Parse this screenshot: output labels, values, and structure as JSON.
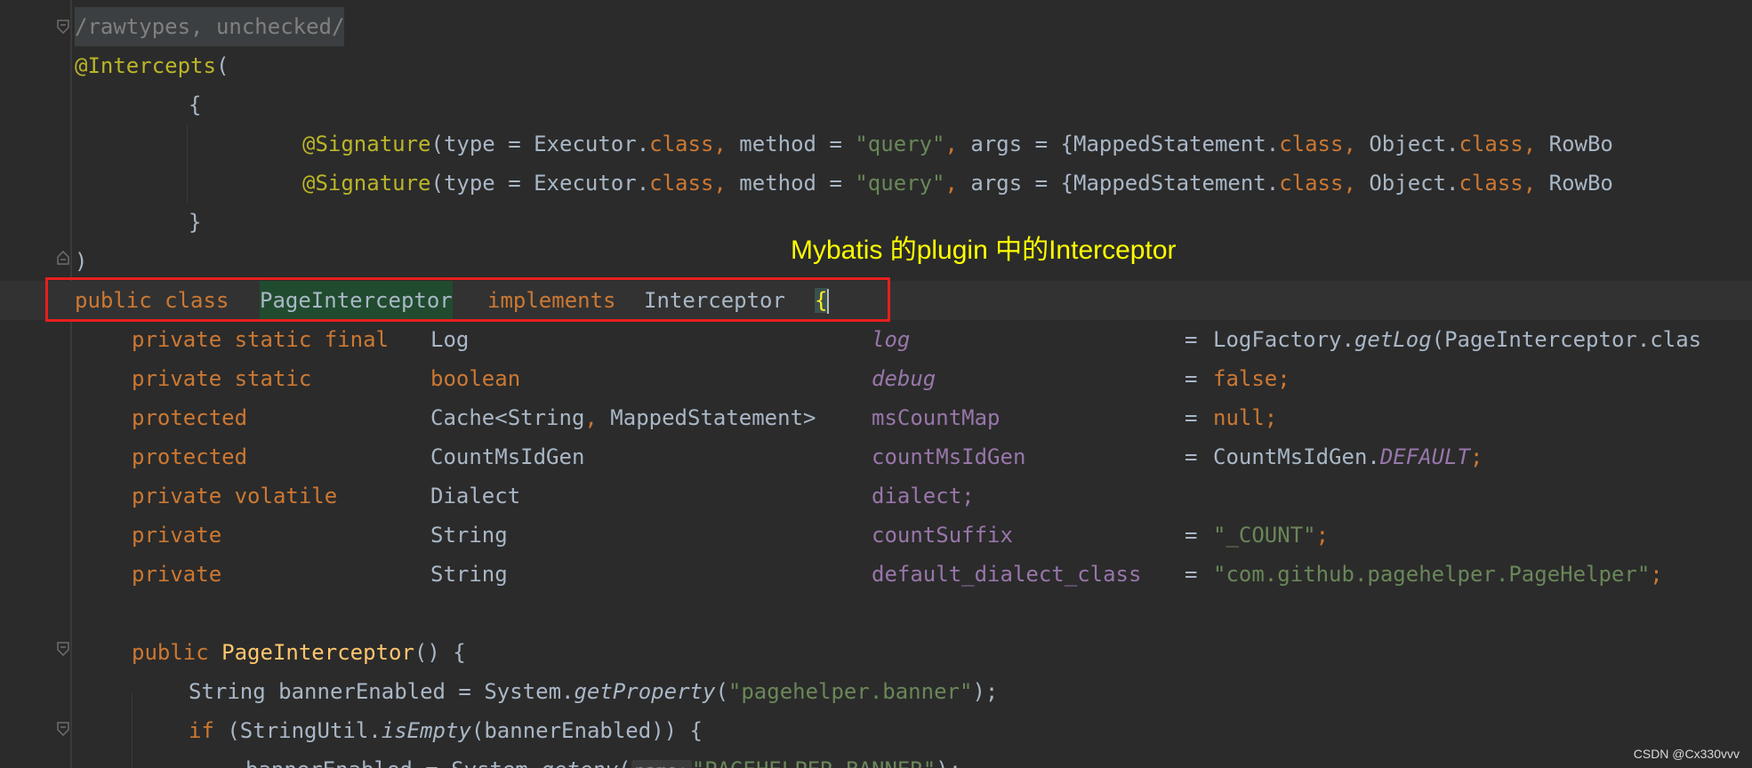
{
  "code": {
    "suppress": "/rawtypes, unchecked/",
    "intercepts": "@Intercepts",
    "open_paren": "(",
    "open_brace": "{",
    "sig_ann": "@Signature",
    "sig_type": "(type = Executor.",
    "kw_class": "class",
    "comma": ",",
    "sig_method": " method = ",
    "sig_query": "\"query\"",
    "sig_args": " args = {MappedStatement.",
    "sig_object": " Object.",
    "sig_rowbo": " RowBo",
    "close_brace": "}",
    "close_paren": ")",
    "decl_public": "public class",
    "decl_class": "PageInterceptor",
    "decl_implements": "implements",
    "decl_interface": "Interceptor",
    "decl_brace": "{",
    "fields": [
      {
        "mods": "private static final",
        "type": "Log",
        "name": "log",
        "eq": "=",
        "value": "LogFactory.",
        "call": "getLog",
        "rest": "(PageInterceptor.clas"
      },
      {
        "mods": "private static",
        "type": "boolean",
        "name": "debug",
        "eq": "=",
        "value": "false;"
      },
      {
        "mods": "protected",
        "type": "Cache<String",
        "type_comma": ",",
        "type2": " MappedStatement>",
        "name": "msCountMap",
        "eq": "=",
        "value": "null;"
      },
      {
        "mods": "protected",
        "type": "CountMsIdGen",
        "name": "countMsIdGen",
        "eq": "=",
        "value": "CountMsIdGen.",
        "const": "DEFAULT",
        "semi": ";"
      },
      {
        "mods": "private volatile",
        "type": "Dialect",
        "name": "dialect;"
      },
      {
        "mods": "private",
        "type": "String",
        "name": "countSuffix",
        "eq": "=",
        "value": "\"_COUNT\"",
        "semi": ";"
      },
      {
        "mods": "private",
        "type": "String",
        "name": "default_dialect_class",
        "eq": "=",
        "value": "\"com.github.pagehelper.PageHelper\"",
        "semi": ";"
      }
    ],
    "ctor_public": "public",
    "ctor_name": "PageInterceptor",
    "ctor_rest": "() {",
    "banner_decl": "String bannerEnabled = System.",
    "banner_call": "getProperty",
    "banner_open": "(",
    "banner_str": "\"pagehelper.banner\"",
    "banner_close": ");",
    "if_kw": "if",
    "if_rest": " (StringUtil.",
    "if_call": "isEmpty",
    "if_tail": "(bannerEnabled)) {",
    "env_decl": "bannerEnabled = System.",
    "env_call": "getenv",
    "env_open": "(",
    "env_hint": "name:",
    "env_str": "\"PAGEHELPER_BANNER\"",
    "env_close": ");"
  },
  "annotation_note": "Mybatis 的plugin 中的Interceptor",
  "watermark": "CSDN @Cx330vvv",
  "colors": {
    "background": "#2b2b2b",
    "keyword": "#cc7832",
    "annotation": "#bbb529",
    "string": "#6a8759",
    "field": "#9876aa",
    "method": "#ffc66d",
    "highlight_box": "#e81e1e",
    "note_text": "#ffff00"
  }
}
